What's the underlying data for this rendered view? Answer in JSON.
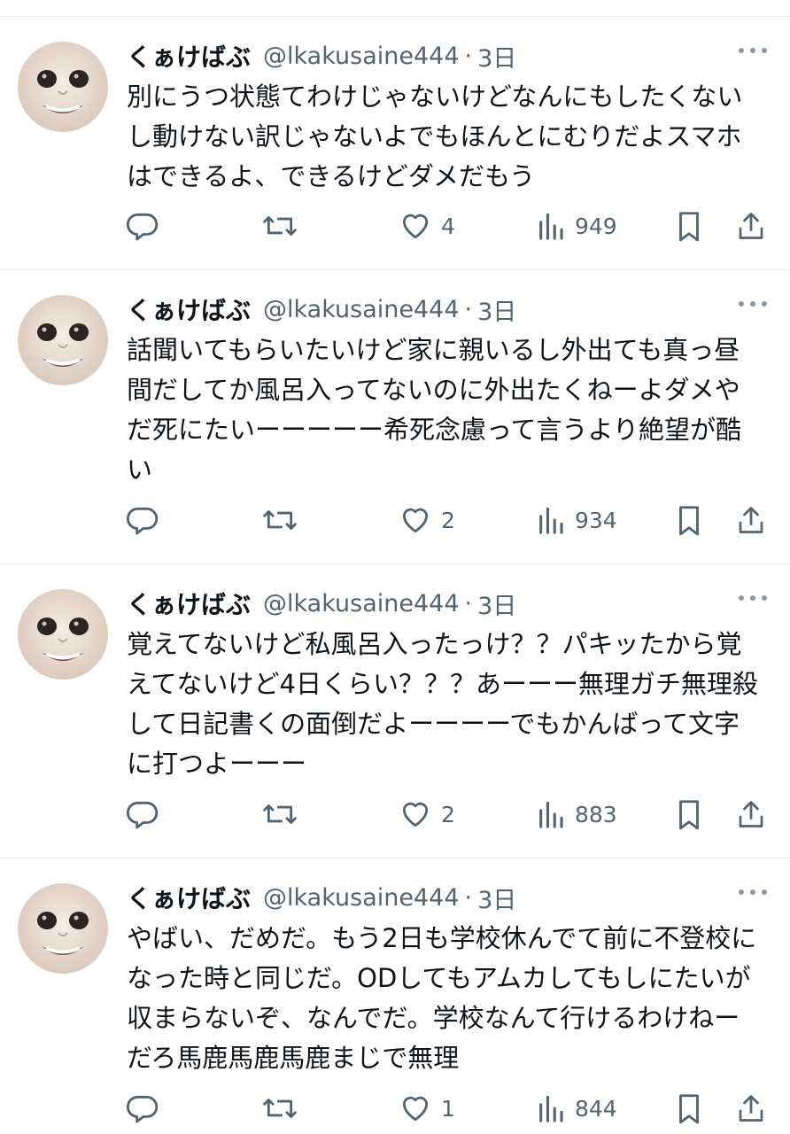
{
  "tweets": [
    {
      "name": "くぁけばぶ",
      "handle": "@lkakusaine444",
      "separator": "·",
      "time": "3日",
      "text": "別にうつ状態てわけじゃないけどなんにもしたくないし動けない訳じゃないよでもほんとにむりだよスマホはできるよ、できるけどダメだもう",
      "likes": "4",
      "views": "949"
    },
    {
      "name": "くぁけばぶ",
      "handle": "@lkakusaine444",
      "separator": "·",
      "time": "3日",
      "text": "話聞いてもらいたいけど家に親いるし外出ても真っ昼間だしてか風呂入ってないのに外出たくねーよダメやだ死にたいーーーーー希死念慮って言うより絶望が酷い",
      "likes": "2",
      "views": "934"
    },
    {
      "name": "くぁけばぶ",
      "handle": "@lkakusaine444",
      "separator": "·",
      "time": "3日",
      "text": "覚えてないけど私風呂入ったっけ？？パキッたから覚えてないけど4日くらい？？？あーーー無理ガチ無理殺して日記書くの面倒だよーーーーでもかんばって文字に打つよーーー",
      "likes": "2",
      "views": "883"
    },
    {
      "name": "くぁけばぶ",
      "handle": "@lkakusaine444",
      "separator": "·",
      "time": "3日",
      "text": "やばい、だめだ。もう2日も学校休んでて前に不登校になった時と同じだ。ODしてもアムカしてもしにたいが収まらないぞ、なんでだ。学校なんて行けるわけねーだろ馬鹿馬鹿馬鹿まじで無理",
      "likes": "1",
      "views": "844"
    }
  ],
  "icons": {
    "reply": "reply-icon",
    "retweet": "retweet-icon",
    "like": "heart-icon",
    "views": "views-icon",
    "bookmark": "bookmark-icon",
    "share": "share-icon",
    "more": "more-dots-icon"
  },
  "colors": {
    "text": "#0f1419",
    "muted": "#536471",
    "divider": "#e6e9ec"
  }
}
